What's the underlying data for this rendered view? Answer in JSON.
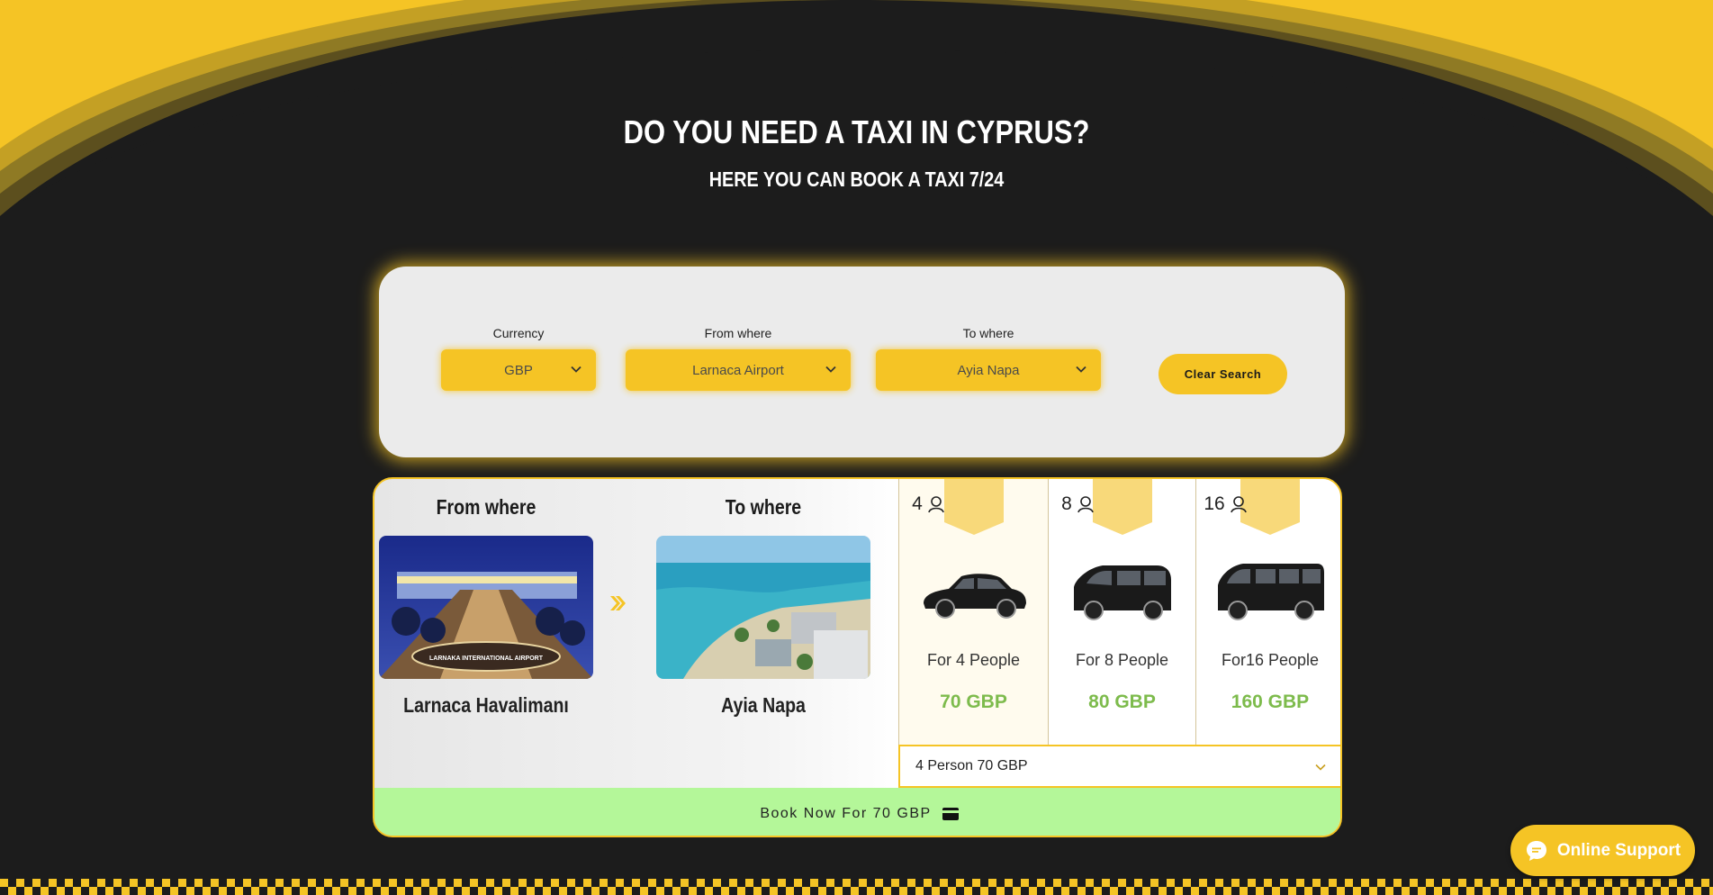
{
  "hero": {
    "title": "DO YOU NEED A TAXI IN CYPRUS?",
    "subtitle": "HERE YOU CAN BOOK A TAXI 7/24"
  },
  "search": {
    "currency": {
      "label": "Currency",
      "value": "GBP"
    },
    "from": {
      "label": "From where",
      "value": "Larnaca Airport"
    },
    "to": {
      "label": "To where",
      "value": "Ayia Napa"
    },
    "clear_label": "Clear Search"
  },
  "result": {
    "from_head": "From where",
    "to_head": "To where",
    "from_name": "Larnaca Havalimanı",
    "from_img_caption": "LARNAKA INTERNATIONAL AIRPORT",
    "to_name": "Ayia Napa",
    "vehicles": [
      {
        "capacity": "4",
        "label": "For 4 People",
        "price": "70 GBP"
      },
      {
        "capacity": "8",
        "label": "For 8 People",
        "price": "80 GBP"
      },
      {
        "capacity": "16",
        "label": "For16 People",
        "price": "160 GBP"
      }
    ],
    "option_selected": "4 Person 70 GBP",
    "book_label": "Book Now For 70 GBP"
  },
  "support": {
    "label": "Online Support"
  },
  "colors": {
    "accent": "#f5c425",
    "price": "#7dbb4c",
    "book_bg": "#b4f799",
    "bg": "#1c1c1c"
  },
  "icons": [
    "chevron-down-icon",
    "person-icon",
    "double-chevron-right-icon",
    "credit-card-icon",
    "chat-bubble-icon"
  ]
}
